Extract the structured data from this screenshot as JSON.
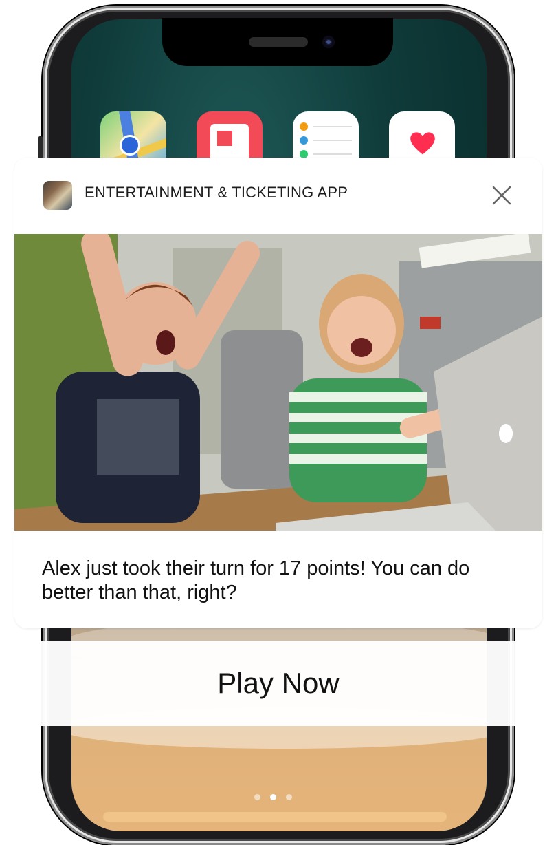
{
  "notification": {
    "app_name": "ENTERTAINMENT & TICKETING APP",
    "close_icon": "close-icon",
    "message": "Alex just took their turn for 17 points! You can do better than that, right?"
  },
  "action": {
    "label": "Play Now"
  },
  "home_screen": {
    "icons": [
      "maps-icon",
      "news-icon",
      "reminders-icon",
      "health-icon"
    ],
    "page_indicator": {
      "pages": 3,
      "current": 2
    }
  },
  "colors": {
    "accent_red": "#f24b57",
    "text": "#111111"
  }
}
